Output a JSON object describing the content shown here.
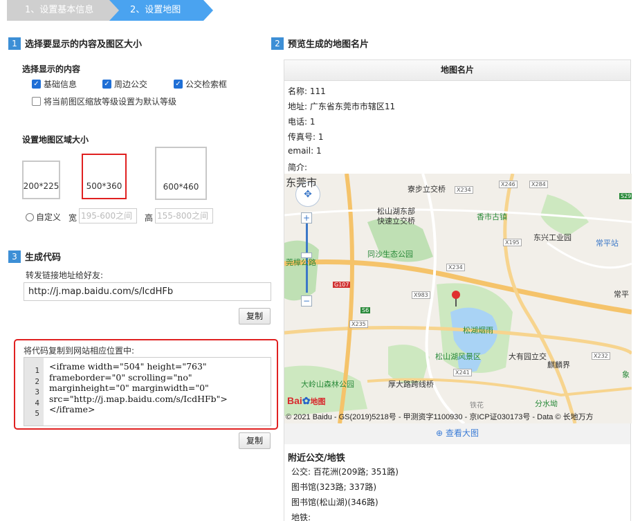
{
  "steps": {
    "step1": "1、设置基本信息",
    "step2": "2、设置地图"
  },
  "section1": {
    "num": "1",
    "title": "选择要显示的内容及图区大小",
    "content_label": "选择显示的内容",
    "checks": {
      "basic": "基础信息",
      "bus": "周边公交",
      "search": "公交检索框",
      "zoom_default": "将当前图区缩放等级设置为默认等级"
    },
    "size_label": "设置地图区域大小",
    "sizes": {
      "small": "200*225",
      "medium": "500*360",
      "large": "600*460"
    },
    "custom": "自定义",
    "width_label": "宽",
    "width_placeholder": "195-600之间",
    "height_label": "高",
    "height_placeholder": "155-800之间"
  },
  "section2": {
    "num": "2",
    "title": "预览生成的地图名片"
  },
  "section3": {
    "num": "3",
    "title": "生成代码",
    "share_label": "转发链接地址给好友:",
    "share_url": "http://j.map.baidu.com/s/IcdHFb",
    "copy_label": "复制",
    "embed_label": "将代码复制到网站相应位置中:",
    "line_numbers": [
      "1",
      "2",
      "3",
      "4",
      "5"
    ],
    "code_lines": [
      "<iframe width=\"504\" height=\"763\"",
      "frameborder=\"0\" scrolling=\"no\"",
      "marginheight=\"0\" marginwidth=\"0\"",
      "src=\"http://j.map.baidu.com/s/IcdHFb\">",
      "</iframe>"
    ],
    "copy_label2": "复制"
  },
  "card": {
    "title": "地图名片",
    "name": "名称: 111",
    "address": "地址: 广东省东莞市市辖区11",
    "phone": "电话: 1",
    "fax": "传真号: 1",
    "email": "email: 1",
    "intro": "简介:",
    "view_big": "查看大图",
    "nearby_title": "附近公交/地铁",
    "nearby": [
      "公交: 百花洲(209路; 351路)",
      "图书馆(323路; 337路)",
      "图书馆(松山湖)(346路)",
      "地铁:"
    ]
  },
  "map": {
    "labels": {
      "dongguan": "东莞市",
      "liaobu": "寮步立交桥",
      "songshan_north": "松山湖东部",
      "kuaisu": "快速立交桥",
      "xiangshi": "香市古镇",
      "dongxing": "东兴工业园",
      "changping": "常平站",
      "tongsha": "同沙生态公园",
      "huangjiang": "莞樟公路",
      "songhu_yanyu": "松湖烟雨",
      "songshan_scenic": "松山湖风景区",
      "dayou": "大有园立交",
      "qilin": "麒麟界",
      "daling": "大岭山森林公园",
      "houdalu": "厚大路跨线桥",
      "fenshui": "分水坳",
      "changping2": "常平",
      "xiang": "象",
      "tiehua": "铁花"
    },
    "roads": [
      "X234",
      "X246",
      "X284",
      "S29",
      "X195",
      "X234",
      "G107",
      "X983",
      "S6",
      "X235",
      "X241",
      "X232"
    ],
    "copyright": "© 2021 Baidu - GS(2019)5218号 - 甲测资字1100930 - 京ICP证030173号 - Data © 长地万方",
    "logo_text": "Bai",
    "logo_text2": "地图"
  }
}
